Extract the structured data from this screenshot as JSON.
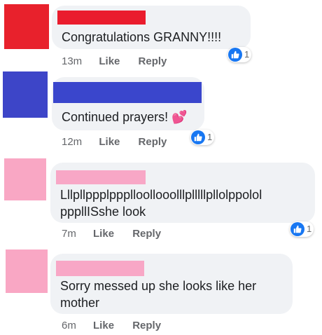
{
  "comments": [
    {
      "avatar_color": "#e8212c",
      "name_color": "#ea1c2d",
      "text_lines": [
        "Congratulations GRANNY!!!!"
      ],
      "time": "13m",
      "like_label": "Like",
      "reply_label": "Reply",
      "reaction_count": "1"
    },
    {
      "avatar_color": "#3d45c8",
      "name_color": "#3a46cc",
      "text_lines": [
        "Continued prayers! 💕"
      ],
      "time": "12m",
      "like_label": "Like",
      "reply_label": "Reply",
      "reaction_count": "1"
    },
    {
      "avatar_color": "#f9a7c4",
      "name_color": "#f8a7c6",
      "text_lines": [
        "Lllpllppplppplloollooolllplllllpllolppolol",
        "pppllISshe look"
      ],
      "time": "7m",
      "like_label": "Like",
      "reply_label": "Reply",
      "reaction_count": "1"
    },
    {
      "avatar_color": "#f9a7c4",
      "name_color": "#f8a7c6",
      "text_lines": [
        "Sorry messed up she looks like her",
        "mother"
      ],
      "time": "6m",
      "like_label": "Like",
      "reply_label": "Reply"
    }
  ],
  "colors": {
    "bubble": "#f0f2f5",
    "text": "#1c1e21",
    "meta": "#65676b",
    "like_reaction": "#1877f2"
  },
  "icons": {
    "reaction": "thumbs-up-icon"
  }
}
